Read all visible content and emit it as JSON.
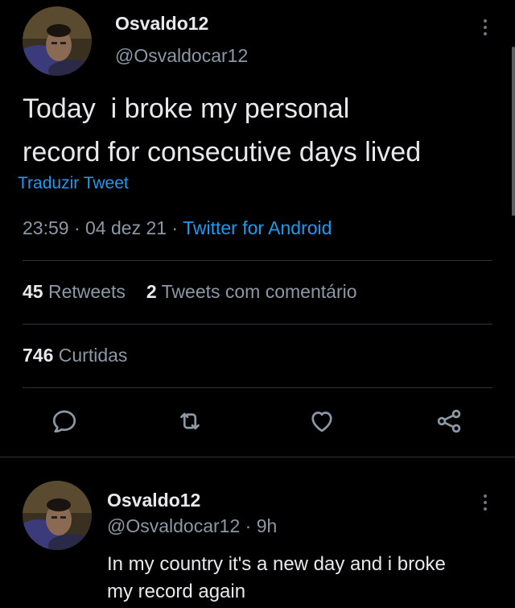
{
  "main_tweet": {
    "author_name": "Osvaldo12",
    "author_handle": "@Osvaldocar12",
    "text_line1": "Today  i broke my personal",
    "text_line2": "record for consecutive days lived",
    "translate_label": "Traduzir Tweet",
    "time": "23:59",
    "date": "04 dez 21",
    "source": "Twitter for Android",
    "separator": " · ",
    "retweets_count": "45",
    "retweets_label": "Retweets",
    "quote_count": "2",
    "quote_label": "Tweets com comentário",
    "likes_count": "746",
    "likes_label": "Curtidas"
  },
  "actions": {
    "reply_icon": "speech-bubble-icon",
    "retweet_icon": "retweet-arrows-icon",
    "like_icon": "heart-icon",
    "share_icon": "share-nodes-icon"
  },
  "reply_tweet": {
    "author_name": "Osvaldo12",
    "author_handle": "@Osvaldocar12",
    "separator": " · ",
    "age": "9h",
    "text_line1": "In my country it's a new day and i broke",
    "text_line2": "my record again"
  },
  "colors": {
    "background": "#000000",
    "text": "#e7e9ea",
    "muted": "#8b98a5",
    "accent": "#1d9bf0",
    "divider": "#2f3336"
  }
}
